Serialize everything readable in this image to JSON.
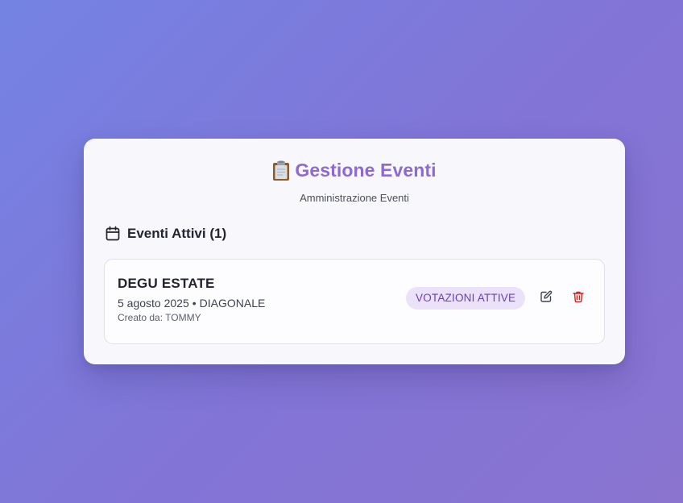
{
  "header": {
    "icon": "clipboard-icon",
    "title": "Gestione Eventi",
    "subtitle": "Amministrazione Eventi"
  },
  "section": {
    "icon": "calendar-icon",
    "title": "Eventi Attivi (1)"
  },
  "events": [
    {
      "name": "DEGU ESTATE",
      "date": "5 agosto 2025",
      "separator": "•",
      "location": "DIAGONALE",
      "creator": "Creato da: TOMMY",
      "status": "VOTAZIONI ATTIVE",
      "actions": {
        "edit_icon": "edit-icon",
        "delete_icon": "trash-icon"
      }
    }
  ],
  "colors": {
    "accent": "#8e6ad0",
    "badge_bg": "#ebe2fa",
    "badge_text": "#6a3fb5",
    "delete": "#d11f1f"
  }
}
